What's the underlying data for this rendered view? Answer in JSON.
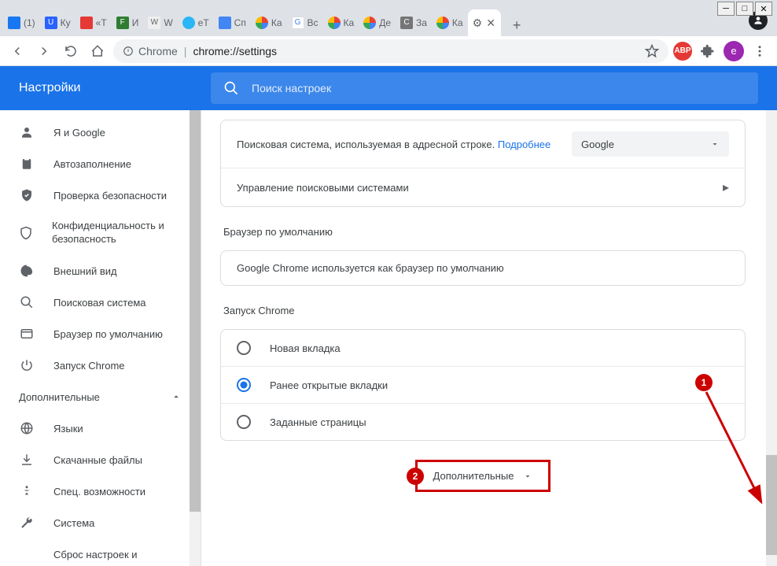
{
  "window": {
    "minimize": "─",
    "maximize": "□",
    "close": "✕"
  },
  "tabs": [
    {
      "label": "(1)",
      "favicon": "#1877f2"
    },
    {
      "label": "Ку",
      "favicon": "#2962ff"
    },
    {
      "label": "«Т",
      "favicon": "#e53935"
    },
    {
      "label": "И",
      "favicon": "#2e7d32"
    },
    {
      "label": "W",
      "favicon": "#eeeeee"
    },
    {
      "label": "eT",
      "favicon": "#29b6f6"
    },
    {
      "label": "Сп",
      "favicon": "#4285f4"
    },
    {
      "label": "Ка",
      "favicon": "#ffffff"
    },
    {
      "label": "Вс",
      "favicon": "#ffffff"
    },
    {
      "label": "Ка",
      "favicon": "#ffffff"
    },
    {
      "label": "Де",
      "favicon": "#ffffff"
    },
    {
      "label": "За",
      "favicon": "#757575"
    },
    {
      "label": "Ка",
      "favicon": "#ffffff"
    }
  ],
  "activeTab": {
    "favicon": "⚙",
    "close": "✕"
  },
  "newTab": "+",
  "toolbar": {
    "omniboxPrefix": "Chrome",
    "omniboxUrl": "chrome://settings",
    "abp": "ABP",
    "profile": "е"
  },
  "header": {
    "title": "Настройки",
    "searchPlaceholder": "Поиск настроек"
  },
  "sidebar": {
    "items": [
      {
        "icon": "person",
        "label": "Я и Google"
      },
      {
        "icon": "autofill",
        "label": "Автозаполнение"
      },
      {
        "icon": "shield-check",
        "label": "Проверка безопасности"
      },
      {
        "icon": "shield",
        "label": "Конфиденциальность и безопасность"
      },
      {
        "icon": "palette",
        "label": "Внешний вид"
      },
      {
        "icon": "search",
        "label": "Поисковая система"
      },
      {
        "icon": "browser",
        "label": "Браузер по умолчанию"
      },
      {
        "icon": "power",
        "label": "Запуск Chrome"
      }
    ],
    "advanced": "Дополнительные",
    "advancedItems": [
      {
        "icon": "globe",
        "label": "Языки"
      },
      {
        "icon": "download",
        "label": "Скачанные файлы"
      },
      {
        "icon": "accessibility",
        "label": "Спец. возможности"
      },
      {
        "icon": "wrench",
        "label": "Система"
      },
      {
        "icon": "reset",
        "label": "Сброс настроек и"
      }
    ]
  },
  "content": {
    "searchEngine": {
      "text": "Поисковая система, используемая в адресной строке.",
      "link": "Подробнее",
      "selected": "Google",
      "manage": "Управление поисковыми системами"
    },
    "defaultBrowser": {
      "title": "Браузер по умолчанию",
      "text": "Google Chrome используется как браузер по умолчанию"
    },
    "startup": {
      "title": "Запуск Chrome",
      "options": [
        {
          "label": "Новая вкладка",
          "checked": false
        },
        {
          "label": "Ранее открытые вкладки",
          "checked": true
        },
        {
          "label": "Заданные страницы",
          "checked": false
        }
      ]
    },
    "advancedBtn": "Дополнительные"
  },
  "annotations": {
    "one": "1",
    "two": "2"
  }
}
